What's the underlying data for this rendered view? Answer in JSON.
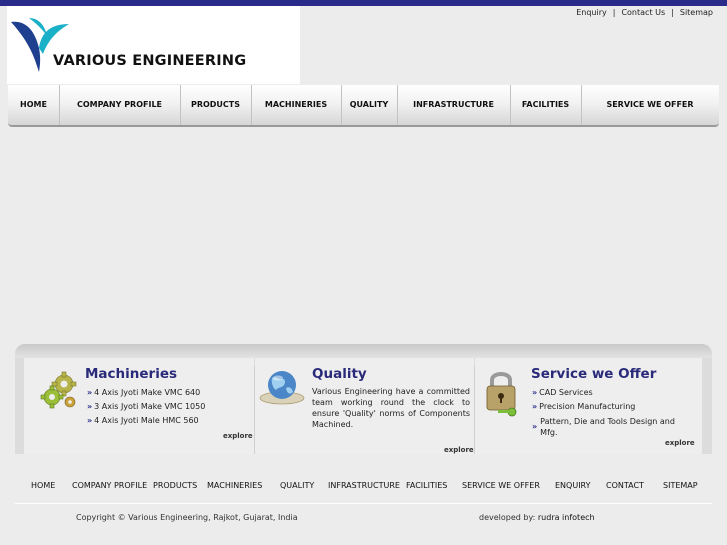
{
  "brand": {
    "name": "VARIOUS ENGINEERING"
  },
  "toplinks": [
    "Enquiry",
    "Contact Us",
    "Sitemap"
  ],
  "nav": [
    "HOME",
    "COMPANY PROFILE",
    "PRODUCTS",
    "MACHINERIES",
    "QUALITY",
    "INFRASTRUCTURE",
    "FACILITIES",
    "SERVICE WE OFFER"
  ],
  "panels": {
    "machineries": {
      "title": "Machineries",
      "items": [
        "4 Axis Jyoti Make VMC 640",
        "3 Axis Jyoti Make VMC 1050",
        "4 Axis Jyoti Male HMC 560"
      ],
      "explore": "explore"
    },
    "quality": {
      "title": "Quality",
      "text": "Various Engineering have a committed team working round the clock to ensure 'Quality' norms of Components Machined.",
      "explore": "explore"
    },
    "service": {
      "title": "Service we Offer",
      "items": [
        "CAD Services",
        "Precision Manufacturing",
        "Pattern, Die and Tools Design and Mfg."
      ],
      "explore": "explore"
    }
  },
  "footer_nav": [
    "HOME",
    "COMPANY PROFILE",
    "PRODUCTS",
    "MACHINERIES",
    "QUALITY",
    "INFRASTRUCTURE",
    "FACILITIES",
    "SERVICE WE OFFER",
    "ENQUIRY",
    "CONTACT",
    "SITEMAP"
  ],
  "copyright": "Copyright © Various Engineering, Rajkot, Gujarat, India",
  "developed_by_label": "developed by:",
  "developer": "rudra infotech",
  "colors": {
    "topbar": "#2a2a8a",
    "heading": "#2a2a7a",
    "logo_blue": "#1f3f8f",
    "logo_teal": "#1ab0c8"
  },
  "icons": [
    "gears-icon",
    "globe-icon",
    "padlock-key-icon",
    "double-chevron-bullet-icon"
  ]
}
